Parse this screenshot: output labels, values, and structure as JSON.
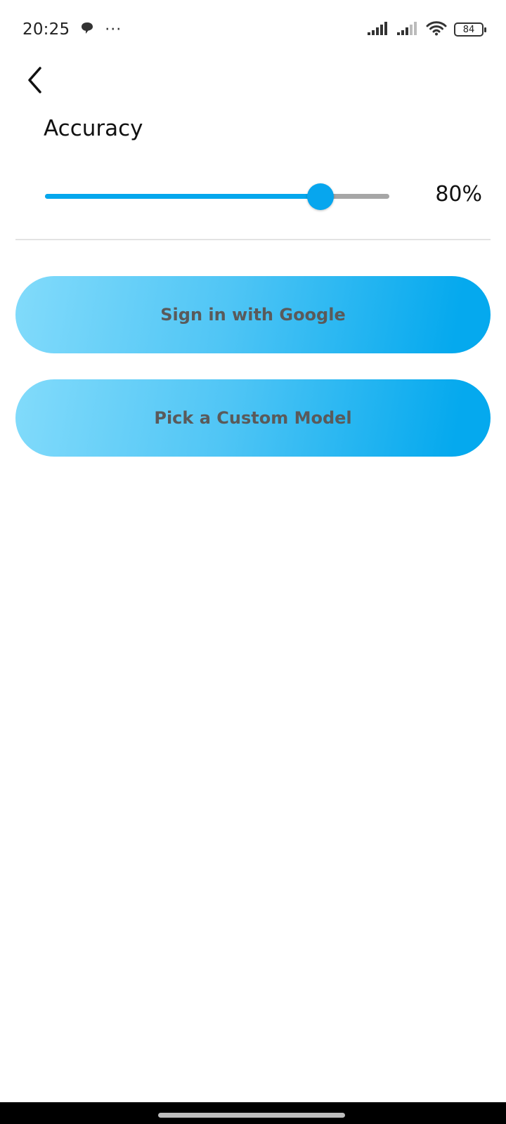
{
  "status_bar": {
    "time": "20:25",
    "notification_icons": [
      "chat-bubble-icon",
      "more-dots-icon"
    ],
    "more_dots": "···",
    "battery_level": "84",
    "system_icons": [
      "signal-icon",
      "signal-icon",
      "wifi-icon",
      "battery-icon"
    ]
  },
  "header": {
    "back_icon": "chevron-left-icon"
  },
  "accuracy": {
    "label": "Accuracy",
    "value_text": "80%",
    "slider_value": 0.8
  },
  "actions": {
    "sign_in_label": "Sign in with Google",
    "custom_model_label": "Pick a Custom Model"
  },
  "colors": {
    "accent": "#05a7ed",
    "gradient_start": "#82dbfb",
    "gradient_end": "#05a9ee",
    "track_inactive": "#a6a6a6",
    "button_text": "#5a5a5a"
  }
}
